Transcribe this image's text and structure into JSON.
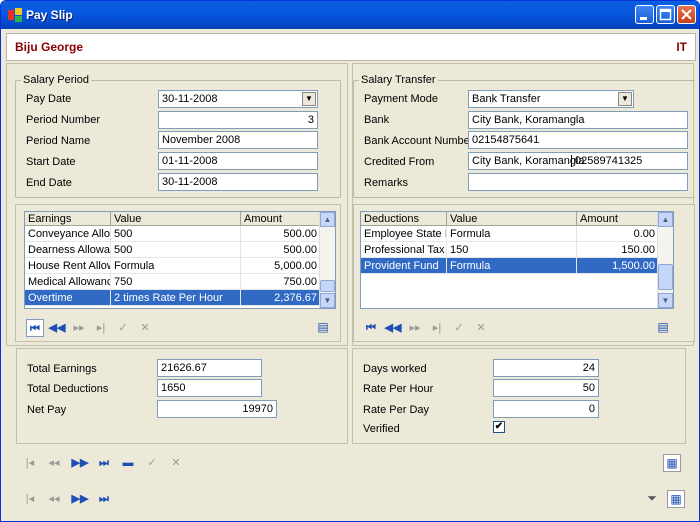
{
  "window": {
    "title": "Pay Slip"
  },
  "employee": {
    "name": "Biju George",
    "department": "IT"
  },
  "salary_period": {
    "legend": "Salary Period",
    "pay_date_label": "Pay Date",
    "pay_date": "30-11-2008",
    "period_number_label": "Period Number",
    "period_number": "3",
    "period_name_label": "Period Name",
    "period_name": "November 2008",
    "start_date_label": "Start Date",
    "start_date": "01-11-2008",
    "end_date_label": "End Date",
    "end_date": "30-11-2008"
  },
  "salary_transfer": {
    "legend": "Salary Transfer",
    "payment_mode_label": "Payment Mode",
    "payment_mode": "Bank Transfer",
    "bank_label": "Bank",
    "bank": "City Bank, Koramangla",
    "account_label": "Bank Account Number",
    "account": "02154875641",
    "credited_from_label": "Credited From",
    "credited_from_bank": "City Bank, Koramangla",
    "credited_from_account": "02589741325",
    "remarks_label": "Remarks",
    "remarks": ""
  },
  "earnings": {
    "headers": [
      "Earnings",
      "Value",
      "Amount"
    ],
    "rows": [
      {
        "name": "Conveyance Allowar",
        "value": "500",
        "amount": "500.00"
      },
      {
        "name": "Dearness Allowance",
        "value": "500",
        "amount": "500.00"
      },
      {
        "name": "House Rent Allowan",
        "value": "Formula",
        "amount": "5,000.00"
      },
      {
        "name": "Medical Allowance",
        "value": "750",
        "amount": "750.00"
      },
      {
        "name": "Overtime",
        "value": "2 times Rate Per Hour",
        "amount": "2,376.67"
      }
    ]
  },
  "deductions": {
    "headers": [
      "Deductions",
      "Value",
      "Amount"
    ],
    "rows": [
      {
        "name": "Employee State Insu",
        "value": "Formula",
        "amount": "0.00"
      },
      {
        "name": "Professional Tax",
        "value": "150",
        "amount": "150.00"
      },
      {
        "name": "Provident Fund",
        "value": "Formula",
        "amount": "1,500.00"
      }
    ]
  },
  "totals": {
    "total_earnings_label": "Total Earnings",
    "total_earnings": "21626.67",
    "total_deductions_label": "Total Deductions",
    "total_deductions": "1650",
    "net_pay_label": "Net Pay",
    "net_pay": "19970"
  },
  "attendance": {
    "days_worked_label": "Days worked",
    "days_worked": "24",
    "rate_per_hour_label": "Rate Per Hour",
    "rate_per_hour": "50",
    "rate_per_day_label": "Rate Per Day",
    "rate_per_day": "0",
    "verified_label": "Verified",
    "verified_mark": "✔"
  },
  "icons": {
    "first": "first-record-icon",
    "prev": "previous-record-icon",
    "next": "next-record-icon",
    "last": "last-record-icon",
    "accept": "accept-icon",
    "cancel": "cancel-icon",
    "delete": "delete-icon",
    "grid": "grid-view-icon",
    "filter": "filter-icon"
  },
  "colors": {
    "title_bar": "#0858e0",
    "employee_text": "#8b0000",
    "selection": "#316ac5"
  }
}
